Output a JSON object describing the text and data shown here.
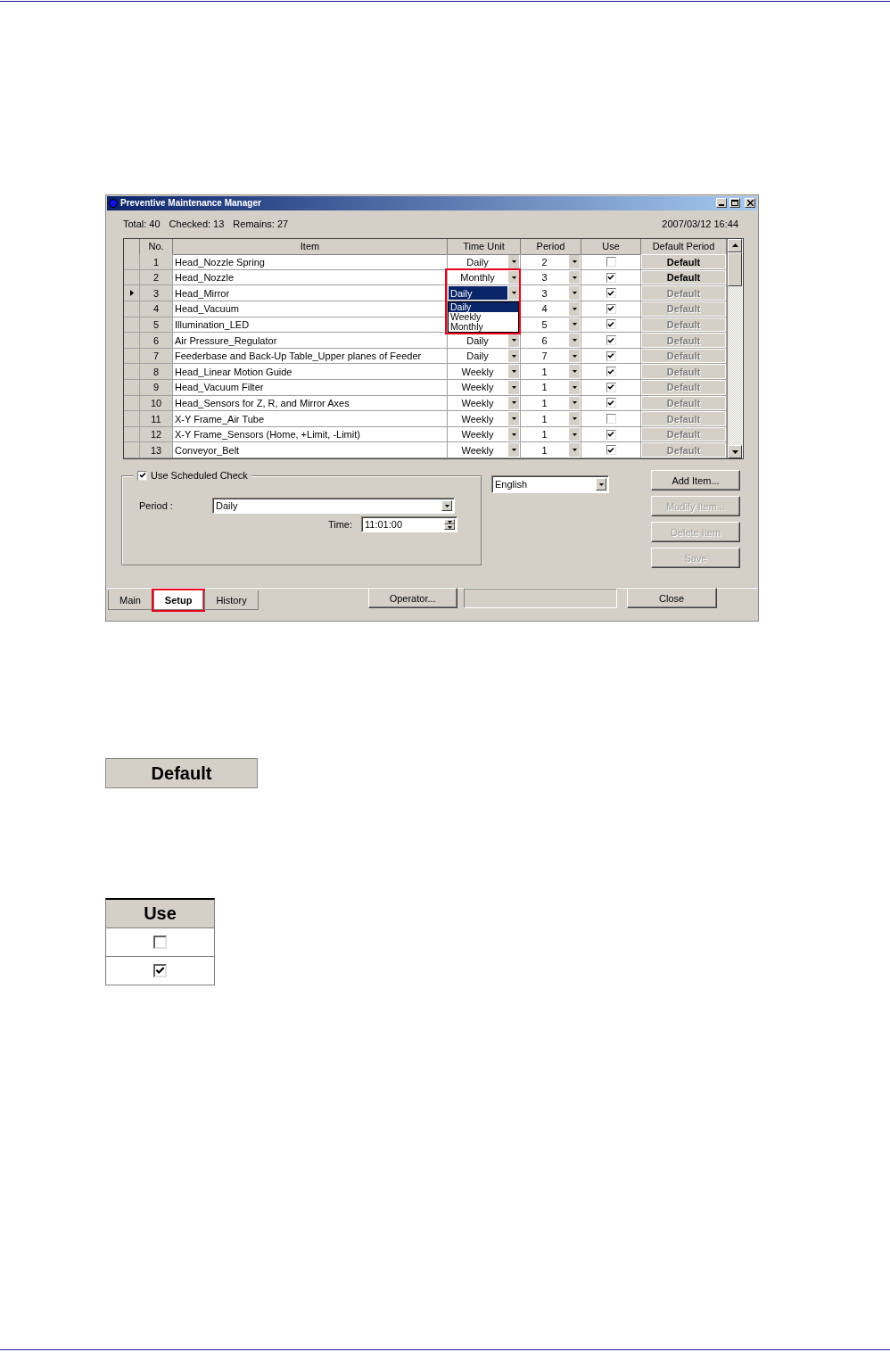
{
  "window": {
    "title": "Preventive Maintenance Manager"
  },
  "summary": {
    "total": "Total: 40",
    "checked": "Checked: 13",
    "remains": "Remains: 27",
    "datetime": "2007/03/12 16:44"
  },
  "table": {
    "columns": [
      "No.",
      "Item",
      "Time Unit",
      "Period",
      "Use",
      "Default Period"
    ],
    "rows": [
      {
        "no": "1",
        "item": "Head_Nozzle Spring",
        "time_unit": "Daily",
        "period": "2",
        "use": false,
        "default": "Default",
        "enabled": true,
        "current": false
      },
      {
        "no": "2",
        "item": "Head_Nozzle",
        "time_unit": "Monthly",
        "period": "3",
        "use": true,
        "default": "Default",
        "enabled": true,
        "current": false
      },
      {
        "no": "3",
        "item": "Head_Mirror",
        "time_unit": "Daily",
        "period": "3",
        "use": true,
        "default": "Default",
        "enabled": false,
        "current": true
      },
      {
        "no": "4",
        "item": "Head_Vacuum",
        "period": "4",
        "use": true,
        "default": "Default",
        "enabled": false,
        "current": false
      },
      {
        "no": "5",
        "item": "Illumination_LED",
        "period": "5",
        "use": true,
        "default": "Default",
        "enabled": false,
        "current": false
      },
      {
        "no": "6",
        "item": "Air Pressure_Regulator",
        "time_unit": "Daily",
        "period": "6",
        "use": true,
        "default": "Default",
        "enabled": false,
        "current": false
      },
      {
        "no": "7",
        "item": "Feederbase and Back-Up Table_Upper planes of Feeder",
        "time_unit": "Daily",
        "period": "7",
        "use": true,
        "default": "Default",
        "enabled": false,
        "current": false
      },
      {
        "no": "8",
        "item": "Head_Linear Motion Guide",
        "time_unit": "Weekly",
        "period": "1",
        "use": true,
        "default": "Default",
        "enabled": false,
        "current": false
      },
      {
        "no": "9",
        "item": "Head_Vacuum Filter",
        "time_unit": "Weekly",
        "period": "1",
        "use": true,
        "default": "Default",
        "enabled": false,
        "current": false
      },
      {
        "no": "10",
        "item": "Head_Sensors for Z, R, and Mirror Axes",
        "time_unit": "Weekly",
        "period": "1",
        "use": true,
        "default": "Default",
        "enabled": false,
        "current": false
      },
      {
        "no": "11",
        "item": "X-Y Frame_Air Tube",
        "time_unit": "Weekly",
        "period": "1",
        "use": false,
        "default": "Default",
        "enabled": false,
        "current": false
      },
      {
        "no": "12",
        "item": "X-Y Frame_Sensors (Home, +Limit, -Limit)",
        "time_unit": "Weekly",
        "period": "1",
        "use": true,
        "default": "Default",
        "enabled": false,
        "current": false
      },
      {
        "no": "13",
        "item": "Conveyor_Belt",
        "time_unit": "Weekly",
        "period": "1",
        "use": true,
        "default": "Default",
        "enabled": false,
        "current": false
      }
    ],
    "time_unit_list": {
      "highlighted": true,
      "options": [
        {
          "label": "Daily",
          "selected": true
        },
        {
          "label": "Weekly",
          "selected": false
        },
        {
          "label": "Monthly",
          "selected": false
        }
      ]
    }
  },
  "schedule": {
    "label": "Use Scheduled Check",
    "checked": true,
    "period_label": "Period :",
    "period": "Daily",
    "time_label": "Time:",
    "time": "11:01:00"
  },
  "language": "English",
  "side_buttons": [
    {
      "label": "Add Item...",
      "disabled": false
    },
    {
      "label": "Modify Item...",
      "disabled": true
    },
    {
      "label": "Delete Item",
      "disabled": true
    },
    {
      "label": "Save",
      "disabled": true
    }
  ],
  "tabs": [
    {
      "label": "Main",
      "selected": false,
      "highlighted": false
    },
    {
      "label": "Setup",
      "selected": true,
      "highlighted": true
    },
    {
      "label": "History",
      "selected": false,
      "highlighted": false
    }
  ],
  "operator_button": "Operator...",
  "close_button": "Close",
  "examples": {
    "default_button": "Default",
    "use_table": {
      "header": "Use",
      "rows": [
        {
          "checked": false
        },
        {
          "checked": true
        }
      ]
    }
  }
}
